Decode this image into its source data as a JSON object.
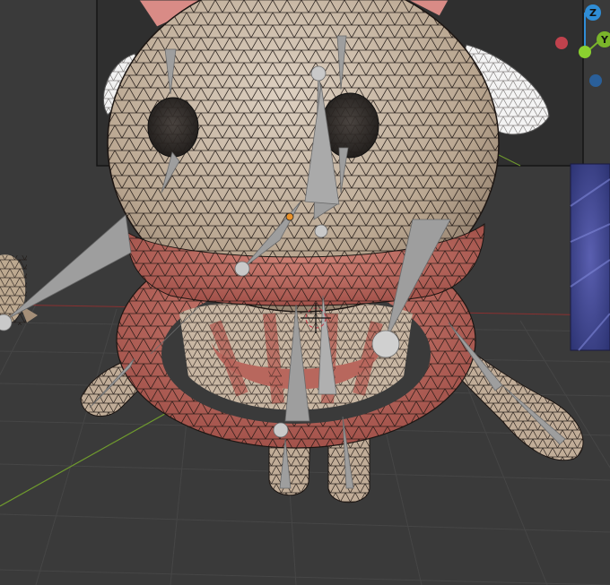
{
  "viewport": {
    "background": "#3a3a3a",
    "grid_color": "#464646",
    "x_axis_color": "#8a3030",
    "y_axis_color": "#6f9a2e",
    "mesh_body_color": "#c3b09c",
    "mesh_mouth_color": "#b8675d",
    "mesh_wire_color": "#1c1512",
    "bone_color": "#9e9e9e"
  },
  "gizmo": {
    "z_label": "Z",
    "y_label": "Y",
    "z_color": "#2f8dd6",
    "y_color": "#7ab52a",
    "x_color": "#c0424d"
  }
}
